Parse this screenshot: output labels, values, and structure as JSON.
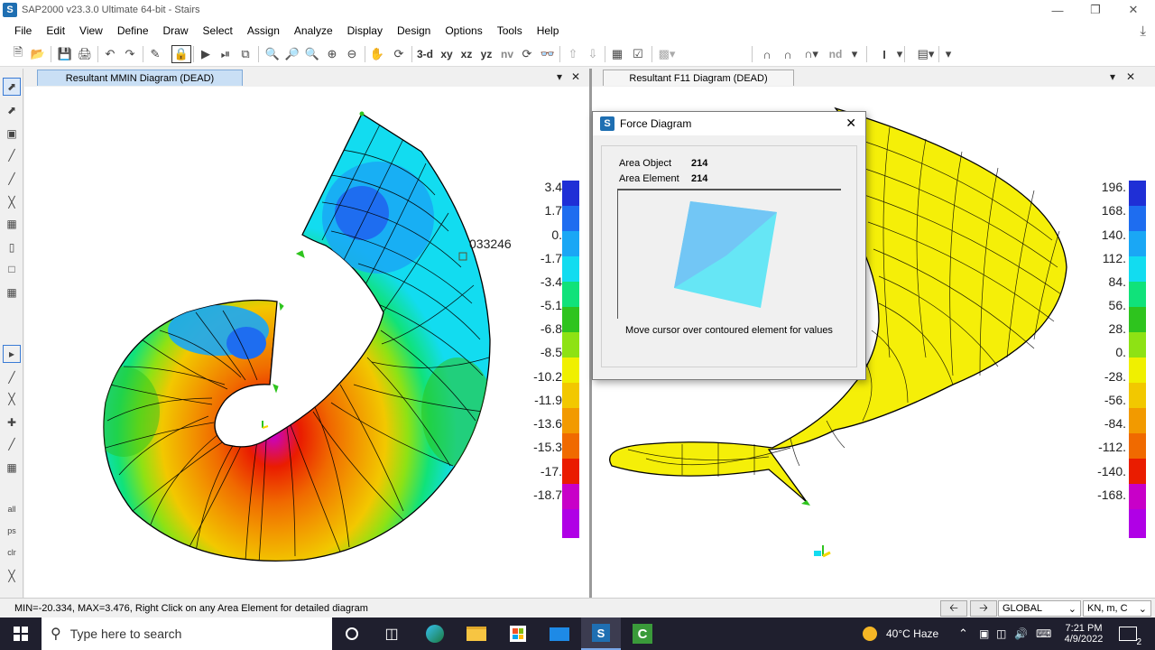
{
  "app": {
    "title": "SAP2000 v23.3.0 Ultimate 64-bit - Stairs",
    "logo": "S"
  },
  "menu": [
    "File",
    "Edit",
    "View",
    "Define",
    "Draw",
    "Select",
    "Assign",
    "Analyze",
    "Display",
    "Design",
    "Options",
    "Tools",
    "Help"
  ],
  "toolbar": {
    "view_3d": "3-d",
    "view_xy": "xy",
    "view_xz": "xz",
    "view_yz": "yz",
    "view_nv": "nv",
    "nd": "nd"
  },
  "left_panel": {
    "tab": "Resultant MMIN Diagram   (DEAD)",
    "partial_label": "033246",
    "legend": [
      "3.4",
      "1.7",
      "0.",
      "-1.7",
      "-3.4",
      "-5.1",
      "-6.8",
      "-8.5",
      "-10.2",
      "-11.9",
      "-13.6",
      "-15.3",
      "-17.",
      "-18.7"
    ]
  },
  "right_panel": {
    "tab": "Resultant F11 Diagram (DEAD)",
    "legend": [
      "196.",
      "168.",
      "140.",
      "112.",
      "84.",
      "56.",
      "28.",
      "0.",
      "-28.",
      "-56.",
      "-84.",
      "-112.",
      "-140.",
      "-168."
    ]
  },
  "dialog": {
    "title": "Force Diagram",
    "area_object_label": "Area Object",
    "area_object_value": "214",
    "area_element_label": "Area Element",
    "area_element_value": "214",
    "message": "Move cursor over contoured element for values"
  },
  "status": {
    "text": "MIN=-20.334, MAX=3.476, Right Click on any Area Element for detailed diagram",
    "coord_system": "GLOBAL",
    "units": "KN, m, C"
  },
  "taskbar": {
    "search_placeholder": "Type here to search",
    "weather": "40°C  Haze",
    "time": "7:21 PM",
    "date": "4/9/2022",
    "notification_count": "2"
  },
  "colors": {
    "contour_scale": [
      "#1f2fd6",
      "#1e6df0",
      "#1aa7f5",
      "#12dcf0",
      "#10e27a",
      "#2ec41e",
      "#8ee214",
      "#f0f000",
      "#f2c800",
      "#f29a00",
      "#f06a00",
      "#ea1c00",
      "#c800c8",
      "#b000e6"
    ],
    "f11_fill": "#f5ef08",
    "accent": "#1f6fb2"
  }
}
